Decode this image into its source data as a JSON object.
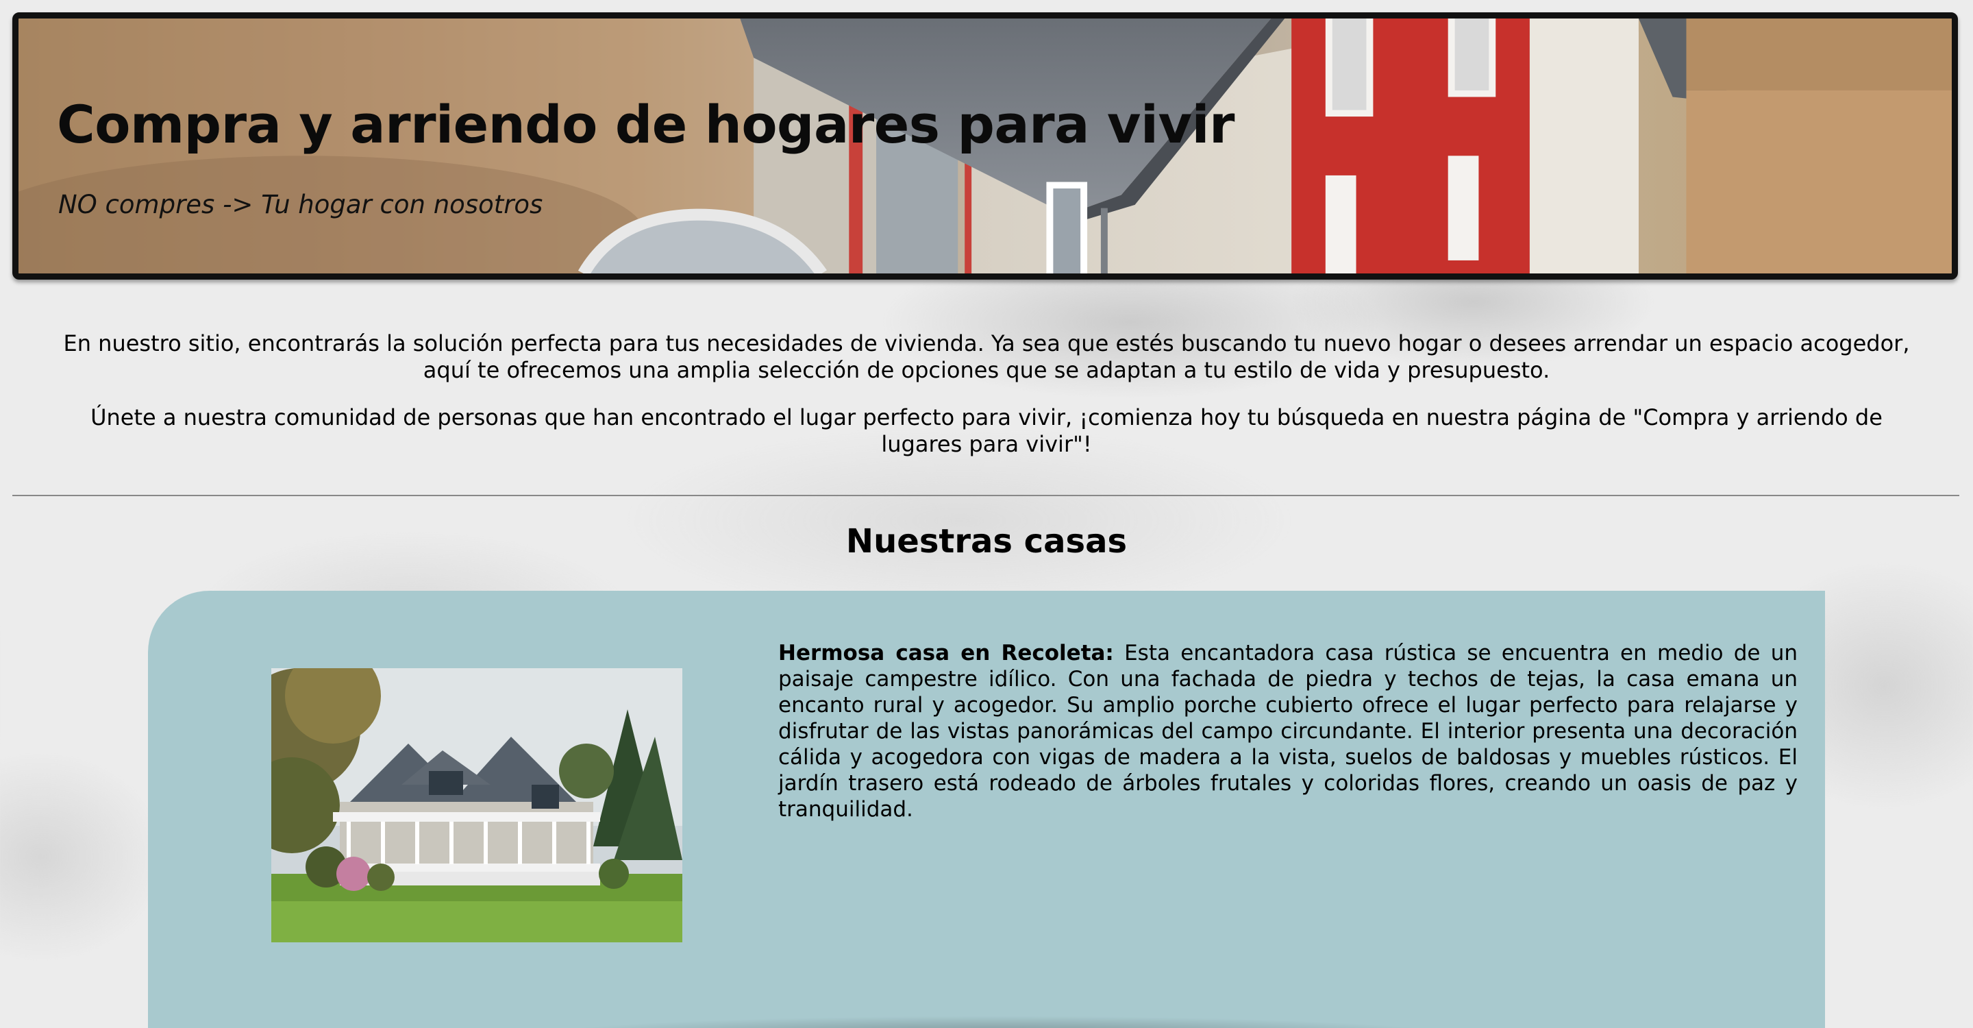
{
  "header": {
    "title": "Compra y arriendo de hogares para vivir",
    "subtitle": "NO compres -> Tu hogar con nosotros"
  },
  "intro": {
    "paragraph_1": "En nuestro sitio, encontrarás la solución perfecta para tus necesidades de vivienda. Ya sea que estés buscando tu nuevo hogar o desees arrendar un espacio acogedor, aquí te ofrecemos una amplia selección de opciones que se adaptan a tu estilo de vida y presupuesto.",
    "paragraph_2": "Únete a nuestra comunidad de personas que han encontrado el lugar perfecto para vivir, ¡comienza hoy tu búsqueda en nuestra página de \"Compra y arriendo de lugares para vivir\"!"
  },
  "houses": {
    "section_title": "Nuestras casas",
    "items": [
      {
        "name": "Hermosa casa en Recoleta:",
        "description": "Esta encantadora casa rústica se encuentra en medio de un paisaje campestre idílico. Con una fachada de piedra y techos de tejas, la casa emana un encanto rural y acogedor. Su amplio porche cubierto ofrece el lugar perfecto para relajarse y disfrutar de las vistas panorámicas del campo circundante. El interior presenta una decoración cálida y acogedora con vigas de madera a la vista, suelos de baldosas y muebles rústicos. El jardín trasero está rodeado de árboles frutales y coloridas flores, creando un oasis de paz y tranquilidad."
      }
    ]
  },
  "colors": {
    "card_background": "#a8c9ce",
    "page_background": "#ececec",
    "header_border": "#111111"
  }
}
